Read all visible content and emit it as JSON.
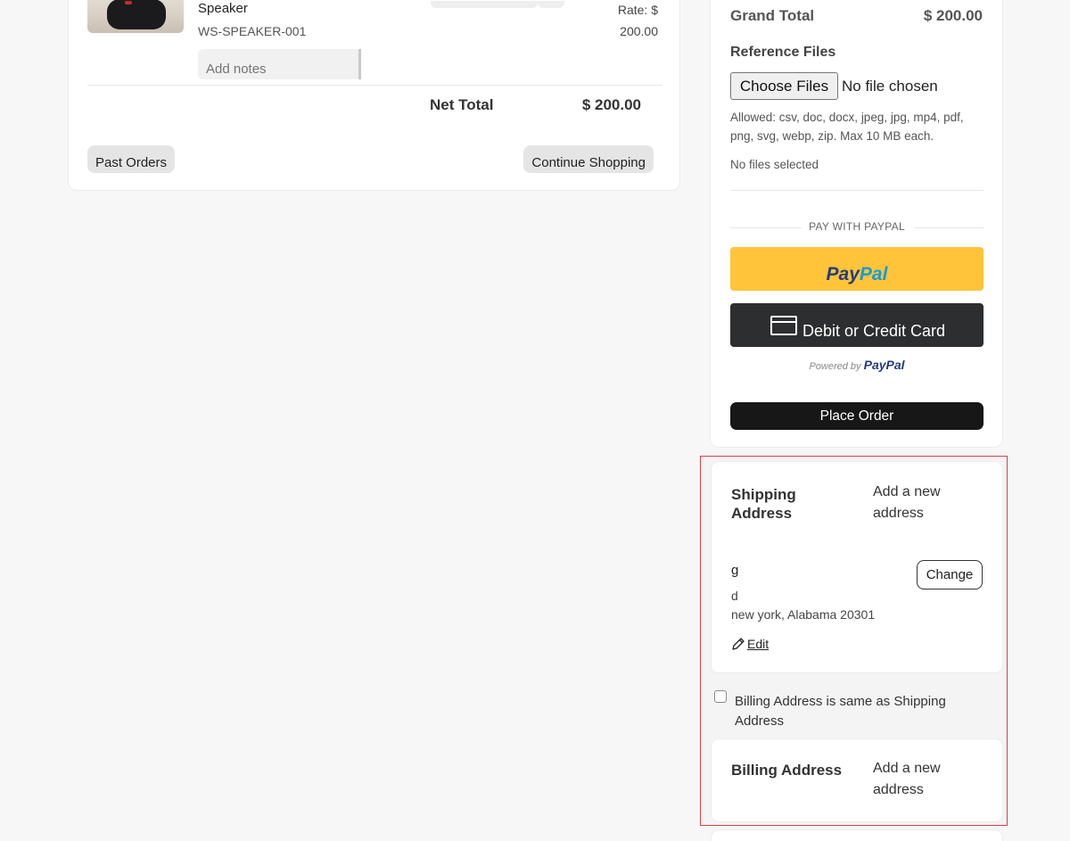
{
  "cart": {
    "product_name": "Speaker",
    "product_sku": "WS-SPEAKER-001",
    "notes_placeholder": "Add notes",
    "rate_label": "Rate: $",
    "rate_value": "200.00",
    "net_total_label": "Net Total",
    "net_total_value": "$ 200.00",
    "past_orders_label": "Past Orders",
    "continue_label": "Continue Shopping"
  },
  "summary": {
    "grand_total_label": "Grand Total",
    "grand_total_value": "$ 200.00",
    "reference_title": "Reference Files",
    "choose_files_label": "Choose Files",
    "no_file_chosen": "No file chosen",
    "allowed_text": "Allowed: csv, doc, docx, jpeg, jpg, mp4, pdf, png, svg, webp, zip. Max 10 MB each.",
    "no_files_selected": "No files selected",
    "pay_with_label": "PAY WITH PAYPAL",
    "paypal_logo_dark": "Pay",
    "paypal_logo_light": "Pal",
    "card_button_label": "Debit or Credit Card",
    "powered_by": "Powered by",
    "powered_brand": "PayPal",
    "place_order_label": "Place Order"
  },
  "shipping": {
    "title": "Shipping Address",
    "add_new": "Add a new address",
    "name": "g",
    "line2": "d",
    "line3": "new york, Alabama 20301",
    "change_label": "Change",
    "edit_label": "Edit"
  },
  "billing": {
    "same_as_shipping": "Billing Address is same as Shipping Address",
    "same_checked": false,
    "title": "Billing Address",
    "add_new": "Add a new address"
  },
  "colors": {
    "paypal_yellow": "#ffc439",
    "paypal_dark_blue": "#253b80",
    "paypal_light_blue": "#179bd7",
    "card_button": "#2c2e2f",
    "place_order": "#171717",
    "highlight_border": "#dd3d4a"
  }
}
